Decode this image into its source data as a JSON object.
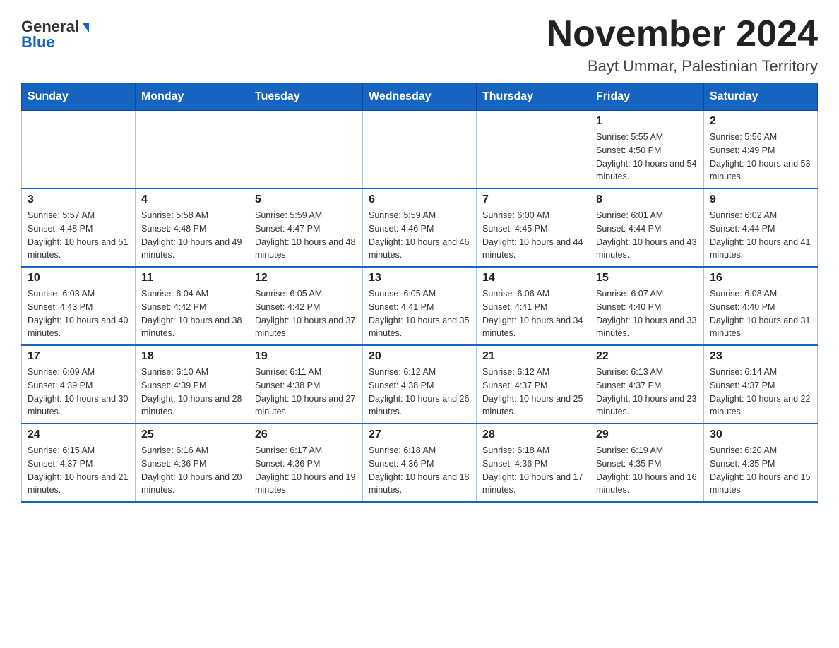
{
  "logo": {
    "general": "General",
    "blue": "Blue"
  },
  "header": {
    "month_year": "November 2024",
    "location": "Bayt Ummar, Palestinian Territory"
  },
  "weekdays": [
    "Sunday",
    "Monday",
    "Tuesday",
    "Wednesday",
    "Thursday",
    "Friday",
    "Saturday"
  ],
  "weeks": [
    [
      {
        "day": "",
        "info": ""
      },
      {
        "day": "",
        "info": ""
      },
      {
        "day": "",
        "info": ""
      },
      {
        "day": "",
        "info": ""
      },
      {
        "day": "",
        "info": ""
      },
      {
        "day": "1",
        "info": "Sunrise: 5:55 AM\nSunset: 4:50 PM\nDaylight: 10 hours and 54 minutes."
      },
      {
        "day": "2",
        "info": "Sunrise: 5:56 AM\nSunset: 4:49 PM\nDaylight: 10 hours and 53 minutes."
      }
    ],
    [
      {
        "day": "3",
        "info": "Sunrise: 5:57 AM\nSunset: 4:48 PM\nDaylight: 10 hours and 51 minutes."
      },
      {
        "day": "4",
        "info": "Sunrise: 5:58 AM\nSunset: 4:48 PM\nDaylight: 10 hours and 49 minutes."
      },
      {
        "day": "5",
        "info": "Sunrise: 5:59 AM\nSunset: 4:47 PM\nDaylight: 10 hours and 48 minutes."
      },
      {
        "day": "6",
        "info": "Sunrise: 5:59 AM\nSunset: 4:46 PM\nDaylight: 10 hours and 46 minutes."
      },
      {
        "day": "7",
        "info": "Sunrise: 6:00 AM\nSunset: 4:45 PM\nDaylight: 10 hours and 44 minutes."
      },
      {
        "day": "8",
        "info": "Sunrise: 6:01 AM\nSunset: 4:44 PM\nDaylight: 10 hours and 43 minutes."
      },
      {
        "day": "9",
        "info": "Sunrise: 6:02 AM\nSunset: 4:44 PM\nDaylight: 10 hours and 41 minutes."
      }
    ],
    [
      {
        "day": "10",
        "info": "Sunrise: 6:03 AM\nSunset: 4:43 PM\nDaylight: 10 hours and 40 minutes."
      },
      {
        "day": "11",
        "info": "Sunrise: 6:04 AM\nSunset: 4:42 PM\nDaylight: 10 hours and 38 minutes."
      },
      {
        "day": "12",
        "info": "Sunrise: 6:05 AM\nSunset: 4:42 PM\nDaylight: 10 hours and 37 minutes."
      },
      {
        "day": "13",
        "info": "Sunrise: 6:05 AM\nSunset: 4:41 PM\nDaylight: 10 hours and 35 minutes."
      },
      {
        "day": "14",
        "info": "Sunrise: 6:06 AM\nSunset: 4:41 PM\nDaylight: 10 hours and 34 minutes."
      },
      {
        "day": "15",
        "info": "Sunrise: 6:07 AM\nSunset: 4:40 PM\nDaylight: 10 hours and 33 minutes."
      },
      {
        "day": "16",
        "info": "Sunrise: 6:08 AM\nSunset: 4:40 PM\nDaylight: 10 hours and 31 minutes."
      }
    ],
    [
      {
        "day": "17",
        "info": "Sunrise: 6:09 AM\nSunset: 4:39 PM\nDaylight: 10 hours and 30 minutes."
      },
      {
        "day": "18",
        "info": "Sunrise: 6:10 AM\nSunset: 4:39 PM\nDaylight: 10 hours and 28 minutes."
      },
      {
        "day": "19",
        "info": "Sunrise: 6:11 AM\nSunset: 4:38 PM\nDaylight: 10 hours and 27 minutes."
      },
      {
        "day": "20",
        "info": "Sunrise: 6:12 AM\nSunset: 4:38 PM\nDaylight: 10 hours and 26 minutes."
      },
      {
        "day": "21",
        "info": "Sunrise: 6:12 AM\nSunset: 4:37 PM\nDaylight: 10 hours and 25 minutes."
      },
      {
        "day": "22",
        "info": "Sunrise: 6:13 AM\nSunset: 4:37 PM\nDaylight: 10 hours and 23 minutes."
      },
      {
        "day": "23",
        "info": "Sunrise: 6:14 AM\nSunset: 4:37 PM\nDaylight: 10 hours and 22 minutes."
      }
    ],
    [
      {
        "day": "24",
        "info": "Sunrise: 6:15 AM\nSunset: 4:37 PM\nDaylight: 10 hours and 21 minutes."
      },
      {
        "day": "25",
        "info": "Sunrise: 6:16 AM\nSunset: 4:36 PM\nDaylight: 10 hours and 20 minutes."
      },
      {
        "day": "26",
        "info": "Sunrise: 6:17 AM\nSunset: 4:36 PM\nDaylight: 10 hours and 19 minutes."
      },
      {
        "day": "27",
        "info": "Sunrise: 6:18 AM\nSunset: 4:36 PM\nDaylight: 10 hours and 18 minutes."
      },
      {
        "day": "28",
        "info": "Sunrise: 6:18 AM\nSunset: 4:36 PM\nDaylight: 10 hours and 17 minutes."
      },
      {
        "day": "29",
        "info": "Sunrise: 6:19 AM\nSunset: 4:35 PM\nDaylight: 10 hours and 16 minutes."
      },
      {
        "day": "30",
        "info": "Sunrise: 6:20 AM\nSunset: 4:35 PM\nDaylight: 10 hours and 15 minutes."
      }
    ]
  ]
}
